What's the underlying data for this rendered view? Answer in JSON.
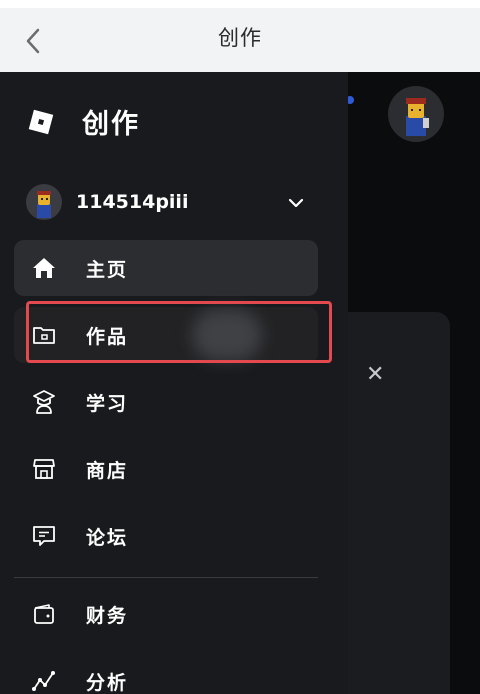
{
  "topbar": {
    "title": "创作",
    "back_icon": "chevron-left-icon"
  },
  "drawer": {
    "brand_title": "创作",
    "user": {
      "name": "114514piii"
    },
    "nav_items": [
      {
        "label": "主页",
        "icon": "home-icon",
        "active": true
      },
      {
        "label": "作品",
        "icon": "folder-icon",
        "highlighted": true
      },
      {
        "label": "学习",
        "icon": "graduation-icon"
      },
      {
        "label": "商店",
        "icon": "store-icon"
      },
      {
        "label": "论坛",
        "icon": "forum-icon"
      }
    ],
    "nav_items_2": [
      {
        "label": "财务",
        "icon": "wallet-icon"
      },
      {
        "label": "分析",
        "icon": "analytics-icon"
      }
    ]
  },
  "background": {
    "partial_text": "",
    "close_icon": "close-icon"
  },
  "colors": {
    "drawer_bg": "#191a1d",
    "active_bg": "#2c2d31",
    "highlight": "#e24a4f",
    "topbar_bg": "#f2f3f5"
  }
}
